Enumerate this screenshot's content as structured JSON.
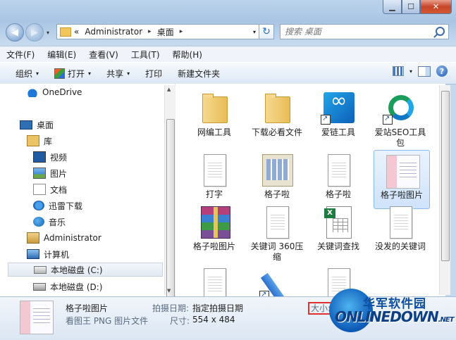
{
  "window": {
    "title": "",
    "controls": {
      "minimize": "▁",
      "maximize": "☐",
      "close": "✕"
    }
  },
  "nav": {
    "back": "◀",
    "forward": "▶",
    "history_arrow": "▾"
  },
  "address": {
    "overflow": "«",
    "segments": [
      "Administrator",
      "桌面"
    ],
    "separator": "▸",
    "dropdown": "▾"
  },
  "refresh": "↻",
  "search": {
    "placeholder": "搜索 桌面"
  },
  "menu": [
    "文件(F)",
    "编辑(E)",
    "查看(V)",
    "工具(T)",
    "帮助(H)"
  ],
  "toolbar": {
    "organize": "组织",
    "open": "打开",
    "share": "共享",
    "print": "打印",
    "new_folder": "新建文件夹",
    "dropdown": "▾",
    "help": "?"
  },
  "sidebar": {
    "items": [
      {
        "label": "OneDrive",
        "icon": "cloud-icon"
      },
      {
        "label": "桌面",
        "icon": "desktop-icon"
      },
      {
        "label": "库",
        "icon": "library-icon"
      },
      {
        "label": "视频",
        "icon": "video-icon"
      },
      {
        "label": "图片",
        "icon": "picture-icon"
      },
      {
        "label": "文档",
        "icon": "document-icon"
      },
      {
        "label": "迅雷下载",
        "icon": "thunder-icon"
      },
      {
        "label": "音乐",
        "icon": "music-icon"
      },
      {
        "label": "Administrator",
        "icon": "user-folder-icon"
      },
      {
        "label": "计算机",
        "icon": "computer-icon"
      },
      {
        "label": "本地磁盘 (C:)",
        "icon": "drive-c-icon",
        "selected": true
      },
      {
        "label": "本地磁盘 (D:)",
        "icon": "drive-d-icon"
      }
    ]
  },
  "files": [
    {
      "label": "网编工具",
      "type": "folder"
    },
    {
      "label": "下载必看文件",
      "type": "folder"
    },
    {
      "label": "爱链工具",
      "type": "app-link"
    },
    {
      "label": "爱站SEO工具包",
      "type": "app-recycle"
    },
    {
      "label": "打字",
      "type": "text"
    },
    {
      "label": "格子啦",
      "type": "grid-app"
    },
    {
      "label": "格子啦",
      "type": "text"
    },
    {
      "label": "格子啦图片",
      "type": "image",
      "selected": true
    },
    {
      "label": "格子啦图片",
      "type": "rar"
    },
    {
      "label": "关键词 360压缩",
      "type": "text"
    },
    {
      "label": "关键词查找",
      "type": "excel"
    },
    {
      "label": "没发的关键词",
      "type": "text"
    },
    {
      "label": "",
      "type": "text"
    },
    {
      "label": "",
      "type": "pencil"
    },
    {
      "label": "",
      "type": "text"
    }
  ],
  "details": {
    "name": "格子啦图片",
    "type": "看图王 PNG 图片文件",
    "date_label": "拍摄日期:",
    "date_value": "指定拍摄日期",
    "dimensions_label": "尺寸:",
    "dimensions_value": "554 x 484",
    "size_label": "大小:"
  },
  "watermark": {
    "cn": "华军软件园",
    "en": "ONLINEDOWN",
    "suffix": ".NET"
  },
  "colors": {
    "accent": "#2c6bb8",
    "close": "#c7442a",
    "highlight": "#e03030"
  }
}
